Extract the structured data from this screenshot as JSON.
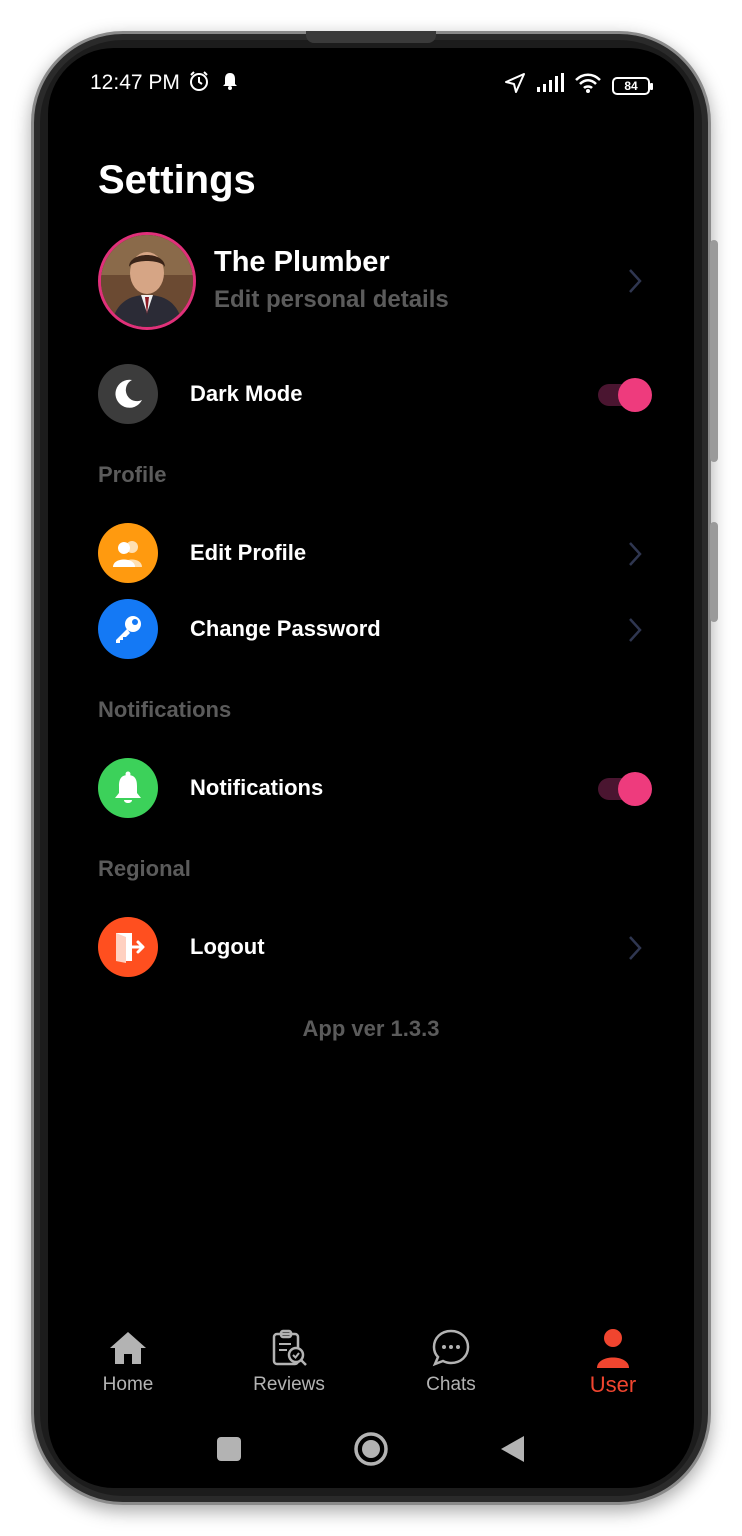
{
  "status_bar": {
    "time": "12:47 PM",
    "battery": "84"
  },
  "page": {
    "title": "Settings"
  },
  "profile": {
    "name": "The Plumber",
    "subtitle": "Edit personal details"
  },
  "dark_mode": {
    "label": "Dark Mode",
    "enabled": true
  },
  "sections": {
    "profile": "Profile",
    "notifications": "Notifications",
    "regional": "Regional"
  },
  "items": {
    "edit_profile": "Edit Profile",
    "change_password": "Change Password",
    "notifications": "Notifications",
    "logout": "Logout"
  },
  "app_version": "App ver 1.3.3",
  "bottom_nav": {
    "home": "Home",
    "reviews": "Reviews",
    "chats": "Chats",
    "user": "User",
    "active": "User"
  },
  "colors": {
    "accent_pink": "#ee3b7d",
    "active_nav": "#f0452f",
    "edit_profile_icon": "#ff9a0f",
    "change_password_icon": "#1479f5",
    "notifications_icon": "#3cd15a",
    "logout_icon": "#ff4f1f",
    "dark_mode_icon": "#3c3c3c"
  }
}
